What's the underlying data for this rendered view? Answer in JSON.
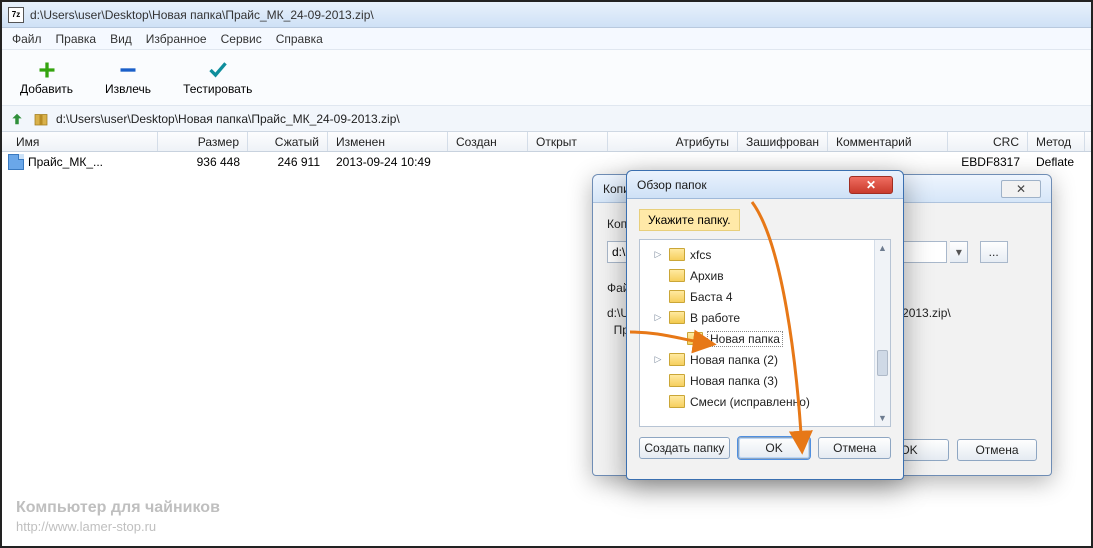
{
  "titlebar": {
    "app_icon": "7z",
    "path": "d:\\Users\\user\\Desktop\\Новая папка\\Прайс_МК_24-09-2013.zip\\"
  },
  "menu": {
    "file": "Файл",
    "edit": "Правка",
    "view": "Вид",
    "fav": "Избранное",
    "tools": "Сервис",
    "help": "Справка"
  },
  "toolbar": {
    "add": "Добавить",
    "extract": "Извлечь",
    "test": "Тестировать"
  },
  "address": "d:\\Users\\user\\Desktop\\Новая папка\\Прайс_МК_24-09-2013.zip\\",
  "cols": {
    "name": "Имя",
    "size": "Размер",
    "packed": "Сжатый",
    "modified": "Изменен",
    "created": "Создан",
    "open": "Открыт",
    "attr": "Атрибуты",
    "enc": "Зашифрован",
    "comment": "Комментарий",
    "crc": "CRC",
    "method": "Метод"
  },
  "rows": [
    {
      "name": "Прайс_МК_...",
      "size": "936 448",
      "packed": "246 911",
      "modified": "2013-09-24 10:49",
      "crc": "EBDF8317",
      "method": "Deflate"
    }
  ],
  "copy": {
    "title": "Копировать",
    "label": "Копировать в:",
    "dest": "d:\\Users\\user\\Desktop\\Новая папка\\",
    "files": "Файлов: 1   ( 936 448 )",
    "list": "d:\\Users\\user\\Desktop\\Новая папка\\Прайс_МК_24-09-2013.zip\\\n  Прайс_МК_24-09-2013.xls",
    "ok": "OK",
    "cancel": "Отмена",
    "dots": "..."
  },
  "browse": {
    "title": "Обзор папок",
    "hint": "Укажите папку.",
    "items": [
      {
        "label": "xfcs",
        "exp": "▷",
        "depth": 0
      },
      {
        "label": "Архив",
        "exp": "",
        "depth": 0
      },
      {
        "label": "Баста 4",
        "exp": "",
        "depth": 0
      },
      {
        "label": "В работе",
        "exp": "▷",
        "depth": 0,
        "open": true
      },
      {
        "label": "Новая папка",
        "exp": "",
        "depth": 1,
        "sel": true
      },
      {
        "label": "Новая папка (2)",
        "exp": "▷",
        "depth": 0
      },
      {
        "label": "Новая папка (3)",
        "exp": "",
        "depth": 0
      },
      {
        "label": "Смеси (исправленно)",
        "exp": "",
        "depth": 0
      }
    ],
    "mk": "Создать папку",
    "ok": "OK",
    "cancel": "Отмена"
  },
  "watermark": {
    "t1": "Компьютер для чайников",
    "t2": "http://www.lamer-stop.ru"
  }
}
